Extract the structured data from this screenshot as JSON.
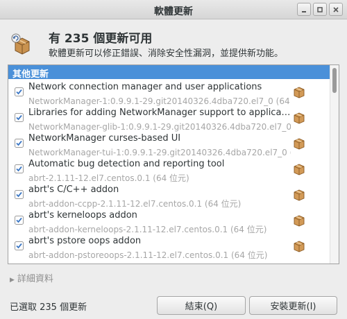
{
  "window": {
    "title": "軟體更新",
    "controls": [
      "minimize",
      "maximize",
      "close"
    ]
  },
  "header": {
    "icon": "package-update-icon",
    "headline": "有 235 個更新可用",
    "subtitle": "軟體更新可以修正錯誤、消除安全性漏洞，並提供新功能。"
  },
  "updates": {
    "group_label": "其他更新",
    "items": [
      {
        "checked": true,
        "title": "Network connection manager and user applications",
        "subtitle": "NetworkManager-1:0.9.9.1-29.git20140326.4dba720.el7_0 (64 位元)"
      },
      {
        "checked": true,
        "title": "Libraries for adding NetworkManager support to applicatio…",
        "subtitle": "NetworkManager-glib-1:0.9.9.1-29.git20140326.4dba720.el7_0 (64 位元)"
      },
      {
        "checked": true,
        "title": "NetworkManager curses-based UI",
        "subtitle": "NetworkManager-tui-1:0.9.9.1-29.git20140326.4dba720.el7_0 (64 位元)"
      },
      {
        "checked": true,
        "title": "Automatic bug detection and reporting tool",
        "subtitle": "abrt-2.1.11-12.el7.centos.0.1 (64 位元)"
      },
      {
        "checked": true,
        "title": "abrt's C/C++ addon",
        "subtitle": "abrt-addon-ccpp-2.1.11-12.el7.centos.0.1 (64 位元)"
      },
      {
        "checked": true,
        "title": "abrt's kerneloops addon",
        "subtitle": "abrt-addon-kerneloops-2.1.11-12.el7.centos.0.1 (64 位元)"
      },
      {
        "checked": true,
        "title": "abrt's pstore oops addon",
        "subtitle": "abrt-addon-pstoreoops-2.1.11-12.el7.centos.0.1 (64 位元)"
      }
    ]
  },
  "details_label": "詳細資料",
  "footer": {
    "selected_text": "已選取 235 個更新",
    "close_label": "結束(Q)",
    "install_label": "安裝更新(I)"
  },
  "colors": {
    "selection_blue": "#4a90d9",
    "secondary_text": "#a6a6a6",
    "package_brown": "#c58a48"
  }
}
